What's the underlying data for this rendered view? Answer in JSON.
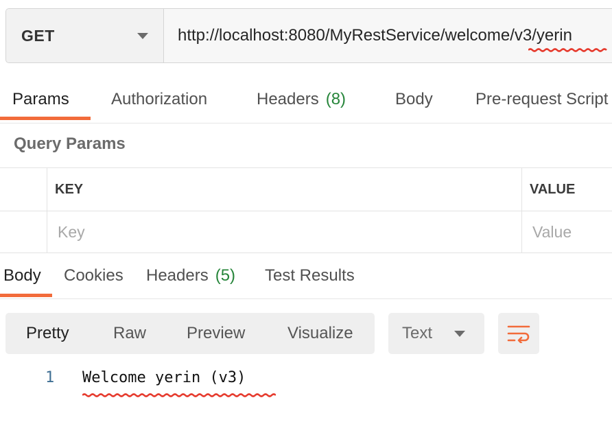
{
  "request": {
    "method": "GET",
    "url": "http://localhost:8080/MyRestService/welcome/v3/yerin"
  },
  "request_tabs": [
    {
      "label": "Params",
      "active": true
    },
    {
      "label": "Authorization"
    },
    {
      "label": "Headers",
      "count": "(8)"
    },
    {
      "label": "Body"
    },
    {
      "label": "Pre-request Script"
    }
  ],
  "query_params": {
    "title": "Query Params",
    "columns": [
      "KEY",
      "VALUE"
    ],
    "placeholders": {
      "key": "Key",
      "value": "Value"
    }
  },
  "response_tabs": [
    {
      "label": "Body",
      "active": true
    },
    {
      "label": "Cookies"
    },
    {
      "label": "Headers",
      "count": "(5)"
    },
    {
      "label": "Test Results"
    }
  ],
  "format": {
    "options": [
      "Pretty",
      "Raw",
      "Preview",
      "Visualize"
    ],
    "selected": "Pretty",
    "type": "Text"
  },
  "response_body": {
    "lines": [
      {
        "number": "1",
        "text": "Welcome yerin (v3)"
      }
    ]
  },
  "colors": {
    "accent": "#f26b3a",
    "count": "#26853a",
    "annotation": "#e63b2e"
  },
  "icons": {
    "method_dropdown": "chevron-down-icon",
    "type_dropdown": "chevron-down-icon",
    "wrap": "wrap-lines-icon"
  }
}
